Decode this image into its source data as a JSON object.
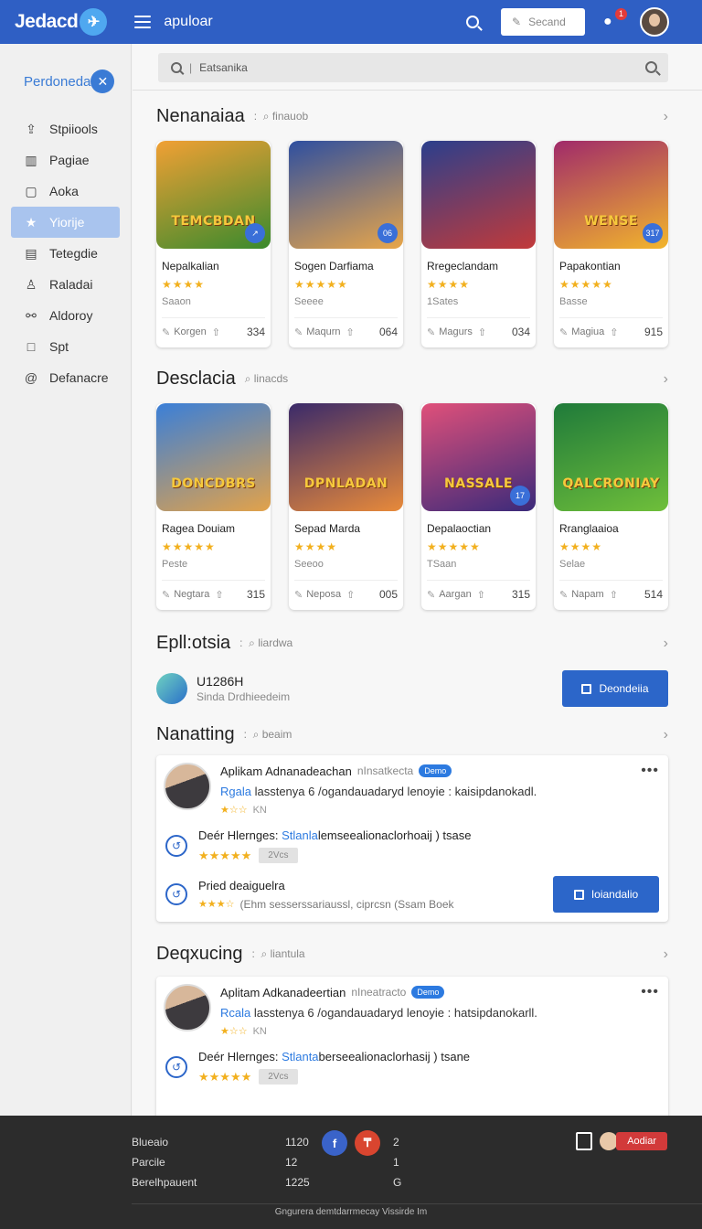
{
  "topbar": {
    "logo": "Jedacd",
    "title": "apuloar",
    "search_placeholder": "Secand",
    "notif_count": "1",
    "colors": {
      "bar": "#2f5fc4",
      "accent": "#3a7bd5",
      "star": "#f2b01e"
    }
  },
  "sidebar": {
    "header": "Perdoneda",
    "items": [
      {
        "label": "Stpiiools",
        "icon": "cloud-upload-icon"
      },
      {
        "label": "Pagiae",
        "icon": "grid-icon"
      },
      {
        "label": "Aoka",
        "icon": "box-icon"
      },
      {
        "label": "Yiorije",
        "icon": "star-icon"
      },
      {
        "label": "Tetegdie",
        "icon": "calendar-icon"
      },
      {
        "label": "Raladai",
        "icon": "user-icon"
      },
      {
        "label": "Aldoroy",
        "icon": "link-icon"
      },
      {
        "label": "Spt",
        "icon": "square-icon"
      },
      {
        "label": "Defanacre",
        "icon": "at-icon"
      }
    ]
  },
  "main": {
    "search_placeholder": "Eatsanika",
    "sections": [
      {
        "title": "Nenanaiaa",
        "sub": "finauob",
        "cards": [
          {
            "title": "Nepalkalian",
            "genre": "Saaon",
            "tag": "Korgen",
            "count": "334",
            "art": "TEMCBDAN",
            "badge": "↗",
            "stars": "★★★★",
            "grad": "#f1a034,#3a8a2d"
          },
          {
            "title": "Sogen Darfiama",
            "genre": "Seeee",
            "tag": "Maqurn",
            "count": "064",
            "art": "",
            "badge": "06",
            "stars": "★★★★★",
            "grad": "#2e4fa0,#e8a64a"
          },
          {
            "title": "Rregeclandam",
            "genre": "1Sates",
            "tag": "Magurs",
            "count": "034",
            "art": "",
            "badge": "",
            "stars": "★★★★",
            "grad": "#2b3f8c,#c23a3a"
          },
          {
            "title": "Papakontian",
            "genre": "Basse",
            "tag": "Magiua",
            "count": "915",
            "art": "WENSE",
            "badge": "317",
            "stars": "★★★★★",
            "grad": "#a02a6a,#f2b52c"
          }
        ]
      },
      {
        "title": "Desclacia",
        "sub": "linacds",
        "cards": [
          {
            "title": "Ragea Douiam",
            "genre": "Peste",
            "tag": "Negtara",
            "count": "315",
            "art": "DONCDBRS",
            "badge": "",
            "stars": "★★★★★",
            "grad": "#3a7fd8,#e2a24a"
          },
          {
            "title": "Sepad Marda",
            "genre": "Seeoo",
            "tag": "Neposa",
            "count": "005",
            "art": "DPNLADAN",
            "badge": "",
            "stars": "★★★★",
            "grad": "#3a2a6a,#e88a3a"
          },
          {
            "title": "Depalaoctian",
            "genre": "TSaan",
            "tag": "Aargan",
            "count": "315",
            "art": "NASSALE",
            "badge": "17",
            "stars": "★★★★★",
            "grad": "#e0507a,#3a2a7a"
          },
          {
            "title": "Rranglaaioa",
            "genre": "Selae",
            "tag": "Napam",
            "count": "514",
            "art": "QALCRONIAY",
            "badge": "",
            "stars": "★★★★",
            "grad": "#1f7a3a,#6fbf3a"
          }
        ]
      }
    ],
    "app_section": {
      "title": "Epll:otsia",
      "sub": "liardwa",
      "app_name": "U1286H",
      "app_sub": "Sinda Drdhieedeim",
      "button": "Deondeiia"
    },
    "review_sections": [
      {
        "title": "Nanatting",
        "sub": "beaim",
        "author": "Aplikam Adnanadeachan",
        "role": "nInsatkecta",
        "badge": "Demo",
        "text_hl": "Rgala",
        "text": "lasstenya 6 /ogandauadaryd lenoyie : kaisipdanokadl.",
        "meta": "KN",
        "line1_title": "Deér Hlernges:",
        "line1_hl": "Stlanla",
        "line1_rest": "lemseealionaclorhoaij ) tsase",
        "line1_pill": "2Vcs",
        "line2_title": "Pried deaiguelra",
        "line2_note": "(Ehm sesserssariaussl, ciprcsn (Ssam Boek",
        "button": "Ioiandalio"
      },
      {
        "title": "Deqxucing",
        "sub": "liantula",
        "author": "Aplitam Adkanadeertian",
        "role": "nIneatracto",
        "badge": "Demo",
        "text_hl": "Rcala",
        "text": "lasstenya 6 /ogandauadaryd lenoyie : hatsipdanokarll.",
        "meta": "KN",
        "line1_title": "Deér Hlernges:",
        "line1_hl": "Stlanta",
        "line1_rest": "berseealionaclorhasij ) tsane",
        "line1_pill": "2Vcs"
      }
    ]
  },
  "footer": {
    "col1": [
      "Blueaio",
      "Parcile",
      "Berelhpauent"
    ],
    "col2": [
      "1120",
      "12",
      "1225"
    ],
    "col3": [
      "2",
      "1",
      "G"
    ],
    "pill": "Aodiar",
    "bottom": "Gngurera demtdarrmecay Vissirde Im"
  }
}
